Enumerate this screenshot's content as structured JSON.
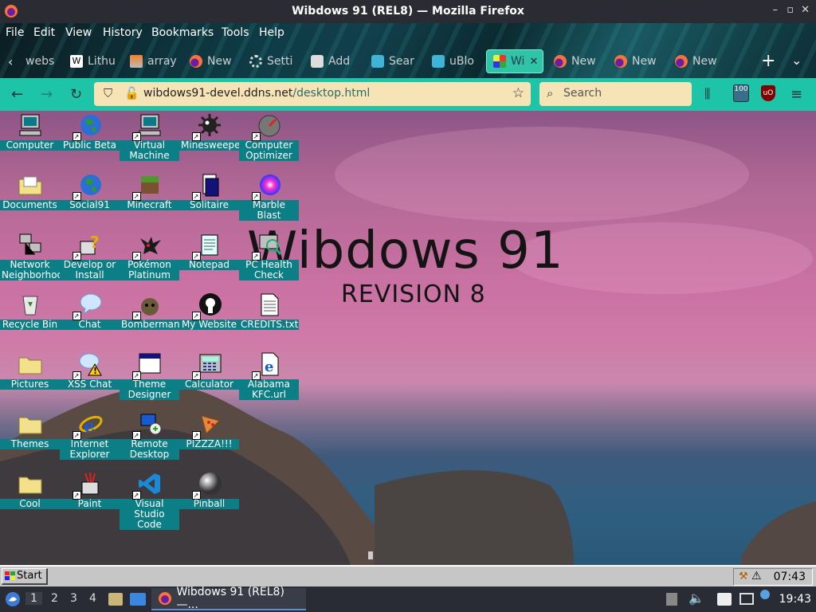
{
  "window": {
    "title": "Wibdows 91 (REL8) — Mozilla Firefox",
    "controls": [
      "–",
      "▫",
      "✕"
    ]
  },
  "menu": [
    "File",
    "Edit",
    "View",
    "History",
    "Bookmarks",
    "Tools",
    "Help"
  ],
  "tabs": [
    {
      "label": "webs",
      "icon": "globe-icon",
      "color": "#8fa"
    },
    {
      "label": "Lithu",
      "icon": "wikipedia-icon",
      "color": "#ffffff"
    },
    {
      "label": "array",
      "icon": "stack-icon",
      "color": "#f48024"
    },
    {
      "label": "New",
      "icon": "firefox-icon",
      "color": "#ff6a3d"
    },
    {
      "label": "Setti",
      "icon": "gear-icon",
      "color": "#dddddd"
    },
    {
      "label": "Add",
      "icon": "puzzle-icon",
      "color": "#dddddd"
    },
    {
      "label": "Sear",
      "icon": "ublock-icon",
      "color": "#3fb4d6"
    },
    {
      "label": "uBlo",
      "icon": "ublock-icon",
      "color": "#3fb4d6"
    },
    {
      "label": "Wi",
      "icon": "wibdows-icon",
      "color": "#ffb000",
      "active": true
    },
    {
      "label": "New",
      "icon": "firefox-icon",
      "color": "#ff6a3d"
    },
    {
      "label": "New",
      "icon": "firefox-icon",
      "color": "#ff6a3d"
    },
    {
      "label": "New",
      "icon": "firefox-icon",
      "color": "#ff6a3d"
    }
  ],
  "nav": {
    "url_host": "wibdows91-devel.ddns.net",
    "url_path": "/desktop.html",
    "search_placeholder": "Search",
    "ublock_count": "100"
  },
  "desktop": {
    "title": "Wibdows 91",
    "subtitle": "REVISION 8",
    "icons": [
      {
        "label": "Computer",
        "icon": "computer-icon",
        "shortcut": false
      },
      {
        "label": "Public Beta",
        "icon": "globe-icon",
        "shortcut": true
      },
      {
        "label": "Virtual Machine",
        "icon": "computer-icon",
        "shortcut": true
      },
      {
        "label": "Minesweeper",
        "icon": "mine-icon",
        "shortcut": true
      },
      {
        "label": "Computer Optimizer",
        "icon": "gauge-icon",
        "shortcut": true
      },
      {
        "label": "Documents",
        "icon": "folder-icon",
        "shortcut": false
      },
      {
        "label": "Social91",
        "icon": "globe-icon",
        "shortcut": true
      },
      {
        "label": "Minecraft",
        "icon": "minecraft-icon",
        "shortcut": true
      },
      {
        "label": "Solitaire",
        "icon": "cards-icon",
        "shortcut": true
      },
      {
        "label": "Marble Blast",
        "icon": "marble-icon",
        "shortcut": true
      },
      {
        "label": "Network Neighborhood",
        "icon": "network-icon",
        "shortcut": false
      },
      {
        "label": "Develop or Install",
        "icon": "help-icon",
        "shortcut": true
      },
      {
        "label": "Pokémon Platinum",
        "icon": "pokemon-icon",
        "shortcut": true
      },
      {
        "label": "Notepad",
        "icon": "notepad-icon",
        "shortcut": true
      },
      {
        "label": "PC Health Check",
        "icon": "health-icon",
        "shortcut": true
      },
      {
        "label": "Recycle Bin",
        "icon": "recycle-bin-icon",
        "shortcut": false
      },
      {
        "label": "Chat",
        "icon": "chat-icon",
        "shortcut": true
      },
      {
        "label": "Bomberman",
        "icon": "bomberman-icon",
        "shortcut": true
      },
      {
        "label": "My Website",
        "icon": "github-icon",
        "shortcut": true
      },
      {
        "label": "CREDITS.txt",
        "icon": "text-file-icon",
        "shortcut": false
      },
      {
        "label": "Pictures",
        "icon": "folder-icon",
        "shortcut": false
      },
      {
        "label": "XSS Chat",
        "icon": "chat-warning-icon",
        "shortcut": true
      },
      {
        "label": "Theme Designer",
        "icon": "window-icon",
        "shortcut": true
      },
      {
        "label": "Calculator",
        "icon": "calculator-icon",
        "shortcut": true
      },
      {
        "label": "Alabama KFC.url",
        "icon": "ie-file-icon",
        "shortcut": true
      },
      {
        "label": "Themes",
        "icon": "folder-icon",
        "shortcut": false
      },
      {
        "label": "Internet Explorer",
        "icon": "ie-icon",
        "shortcut": true
      },
      {
        "label": "Remote Desktop",
        "icon": "remote-desktop-icon",
        "shortcut": true
      },
      {
        "label": "PIZZZA!!!",
        "icon": "pizza-icon",
        "shortcut": true
      },
      {
        "label": "Cool",
        "icon": "folder-icon",
        "shortcut": false
      },
      {
        "label": "Paint",
        "icon": "paint-icon",
        "shortcut": true
      },
      {
        "label": "Visual Studio Code",
        "icon": "vscode-icon",
        "shortcut": true
      },
      {
        "label": "Pinball",
        "icon": "pinball-icon",
        "shortcut": true
      }
    ]
  },
  "w91taskbar": {
    "start_label": "Start",
    "clock": "07:43"
  },
  "panel": {
    "workspaces": [
      "1",
      "2",
      "3",
      "4"
    ],
    "task_label": "Wibdows 91 (REL8) —...",
    "clock": "19:43"
  }
}
